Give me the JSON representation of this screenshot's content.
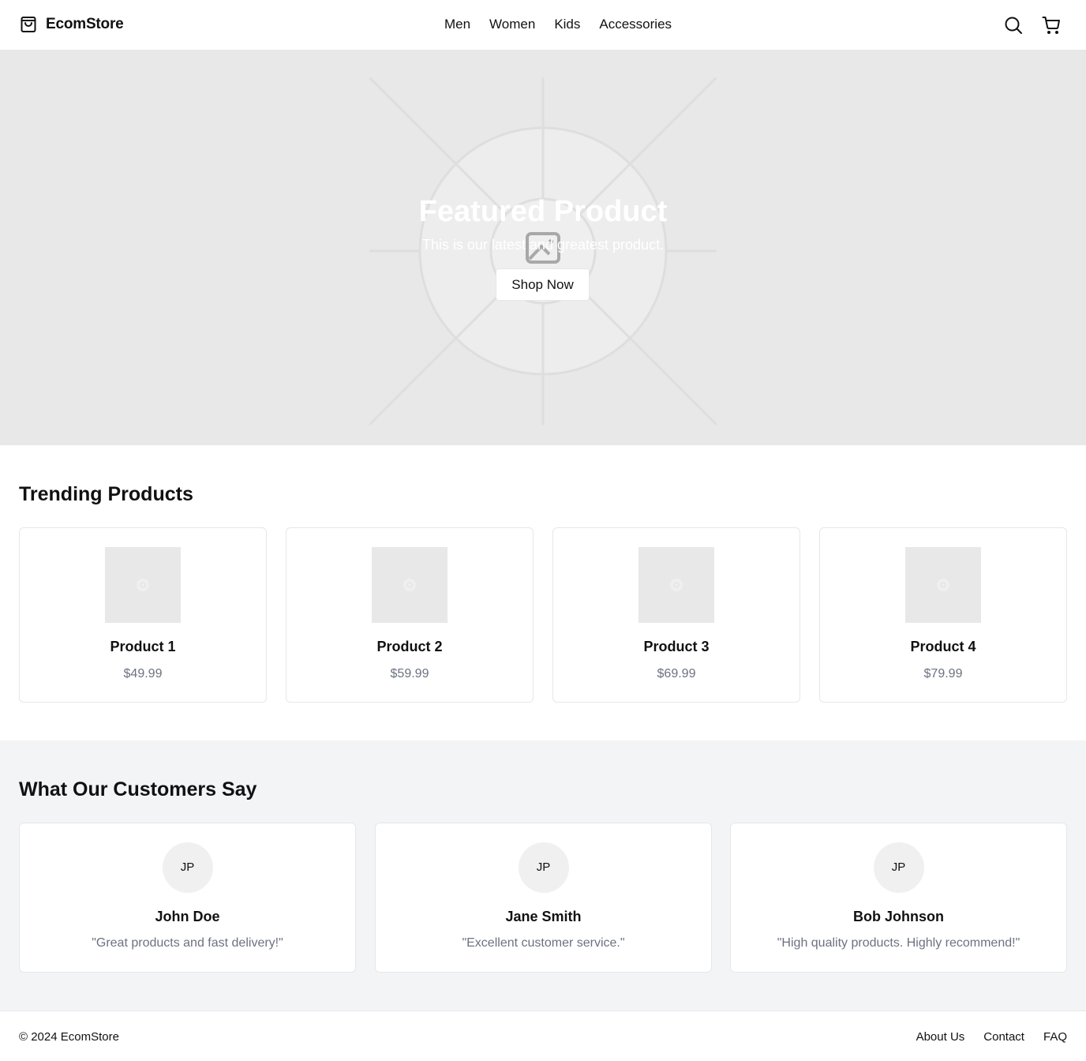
{
  "header": {
    "brand": "EcomStore",
    "brand_icon": "shopping-bag-icon",
    "nav": [
      "Men",
      "Women",
      "Kids",
      "Accessories"
    ],
    "icons": [
      "search-icon",
      "cart-icon"
    ]
  },
  "hero": {
    "title": "Featured Product",
    "subtitle": "This is our latest and greatest product.",
    "button_label": "Shop Now",
    "image_icon": "image-placeholder-icon"
  },
  "trending": {
    "title": "Trending Products",
    "products": [
      {
        "name": "Product 1",
        "price": "$49.99"
      },
      {
        "name": "Product 2",
        "price": "$59.99"
      },
      {
        "name": "Product 3",
        "price": "$69.99"
      },
      {
        "name": "Product 4",
        "price": "$79.99"
      }
    ]
  },
  "testimonials": {
    "title": "What Our Customers Say",
    "items": [
      {
        "initials": "JP",
        "name": "John Doe",
        "quote": "\"Great products and fast delivery!\""
      },
      {
        "initials": "JP",
        "name": "Jane Smith",
        "quote": "\"Excellent customer service.\""
      },
      {
        "initials": "JP",
        "name": "Bob Johnson",
        "quote": "\"High quality products. Highly recommend!\""
      }
    ]
  },
  "footer": {
    "copyright": "© 2024 EcomStore",
    "links": [
      "About Us",
      "Contact",
      "FAQ"
    ]
  },
  "colors": {
    "text": "#111111",
    "muted": "#6b7280",
    "hero_bg": "#e8e8e8",
    "section_bg": "#f3f4f6",
    "border": "#e5e7eb"
  }
}
